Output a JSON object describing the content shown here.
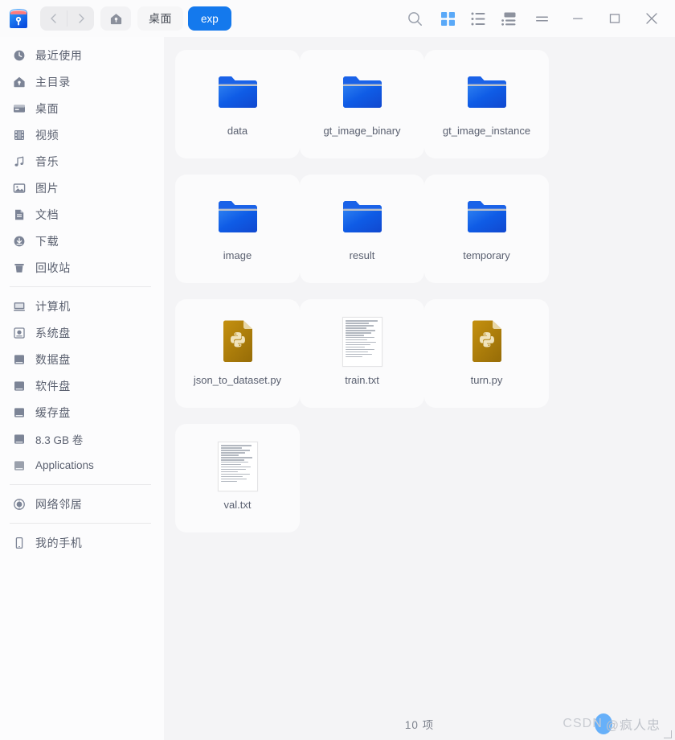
{
  "window": {
    "logo_icon": "file-manager-logo",
    "controls": [
      {
        "name": "minimize",
        "icon": "minimize-icon"
      },
      {
        "name": "maximize",
        "icon": "maximize-icon"
      },
      {
        "name": "close",
        "icon": "close-icon"
      }
    ]
  },
  "toolbar": {
    "back_icon": "chevron-left-icon",
    "forward_icon": "chevron-right-icon",
    "home_icon": "home-icon",
    "search_icon": "search-icon",
    "grid_view_icon": "grid-view-icon",
    "list_view_icon": "list-view-icon",
    "detail_view_icon": "detail-view-icon",
    "menu_icon": "hamburger-menu-icon",
    "breadcrumbs": [
      {
        "label": "桌面",
        "active": false
      },
      {
        "label": "exp",
        "active": true
      }
    ]
  },
  "sidebar": {
    "groups": [
      {
        "items": [
          {
            "label": "最近使用",
            "icon": "clock-icon",
            "latin": false
          },
          {
            "label": "主目录",
            "icon": "home-icon",
            "latin": false
          },
          {
            "label": "桌面",
            "icon": "desktop-icon",
            "latin": false
          },
          {
            "label": "视频",
            "icon": "video-icon",
            "latin": false
          },
          {
            "label": "音乐",
            "icon": "music-icon",
            "latin": false
          },
          {
            "label": "图片",
            "icon": "picture-icon",
            "latin": false
          },
          {
            "label": "文档",
            "icon": "document-icon",
            "latin": false
          },
          {
            "label": "下载",
            "icon": "download-icon",
            "latin": false
          },
          {
            "label": "回收站",
            "icon": "trash-icon",
            "latin": false
          }
        ]
      },
      {
        "items": [
          {
            "label": "计算机",
            "icon": "computer-icon",
            "latin": false
          },
          {
            "label": "系统盘",
            "icon": "system-disk-icon",
            "latin": false
          },
          {
            "label": "数据盘",
            "icon": "disk-icon",
            "latin": false
          },
          {
            "label": "软件盘",
            "icon": "disk-icon",
            "latin": false
          },
          {
            "label": "缓存盘",
            "icon": "disk-icon",
            "latin": false
          },
          {
            "label": "8.3 GB 卷",
            "icon": "disk-icon",
            "latin": true
          },
          {
            "label": "Applications",
            "icon": "disk-icon",
            "latin": true
          }
        ]
      },
      {
        "items": [
          {
            "label": "网络邻居",
            "icon": "network-icon",
            "latin": false
          }
        ]
      },
      {
        "items": [
          {
            "label": "我的手机",
            "icon": "phone-icon",
            "latin": false
          }
        ]
      }
    ]
  },
  "files": [
    {
      "name": "data",
      "type": "folder"
    },
    {
      "name": "gt_image_binary",
      "type": "folder"
    },
    {
      "name": "gt_image_instance",
      "type": "folder"
    },
    {
      "name": "image",
      "type": "folder"
    },
    {
      "name": "result",
      "type": "folder"
    },
    {
      "name": "temporary",
      "type": "folder"
    },
    {
      "name": "json_to_dataset.py",
      "type": "python"
    },
    {
      "name": "train.txt",
      "type": "text"
    },
    {
      "name": "turn.py",
      "type": "python"
    },
    {
      "name": "val.txt",
      "type": "text"
    }
  ],
  "statusbar": {
    "item_count_text": "10 项"
  },
  "watermark": {
    "brand": "CSDN",
    "handle": "@疯人忠"
  },
  "colors": {
    "accent": "#1479ed",
    "folder": "#1565e8",
    "python_file": "#b8860b",
    "sidebar_bg": "#fcfcfd",
    "content_bg": "#f4f4f6",
    "tile_bg": "#fbfbfc",
    "label_text": "#5a6070"
  }
}
